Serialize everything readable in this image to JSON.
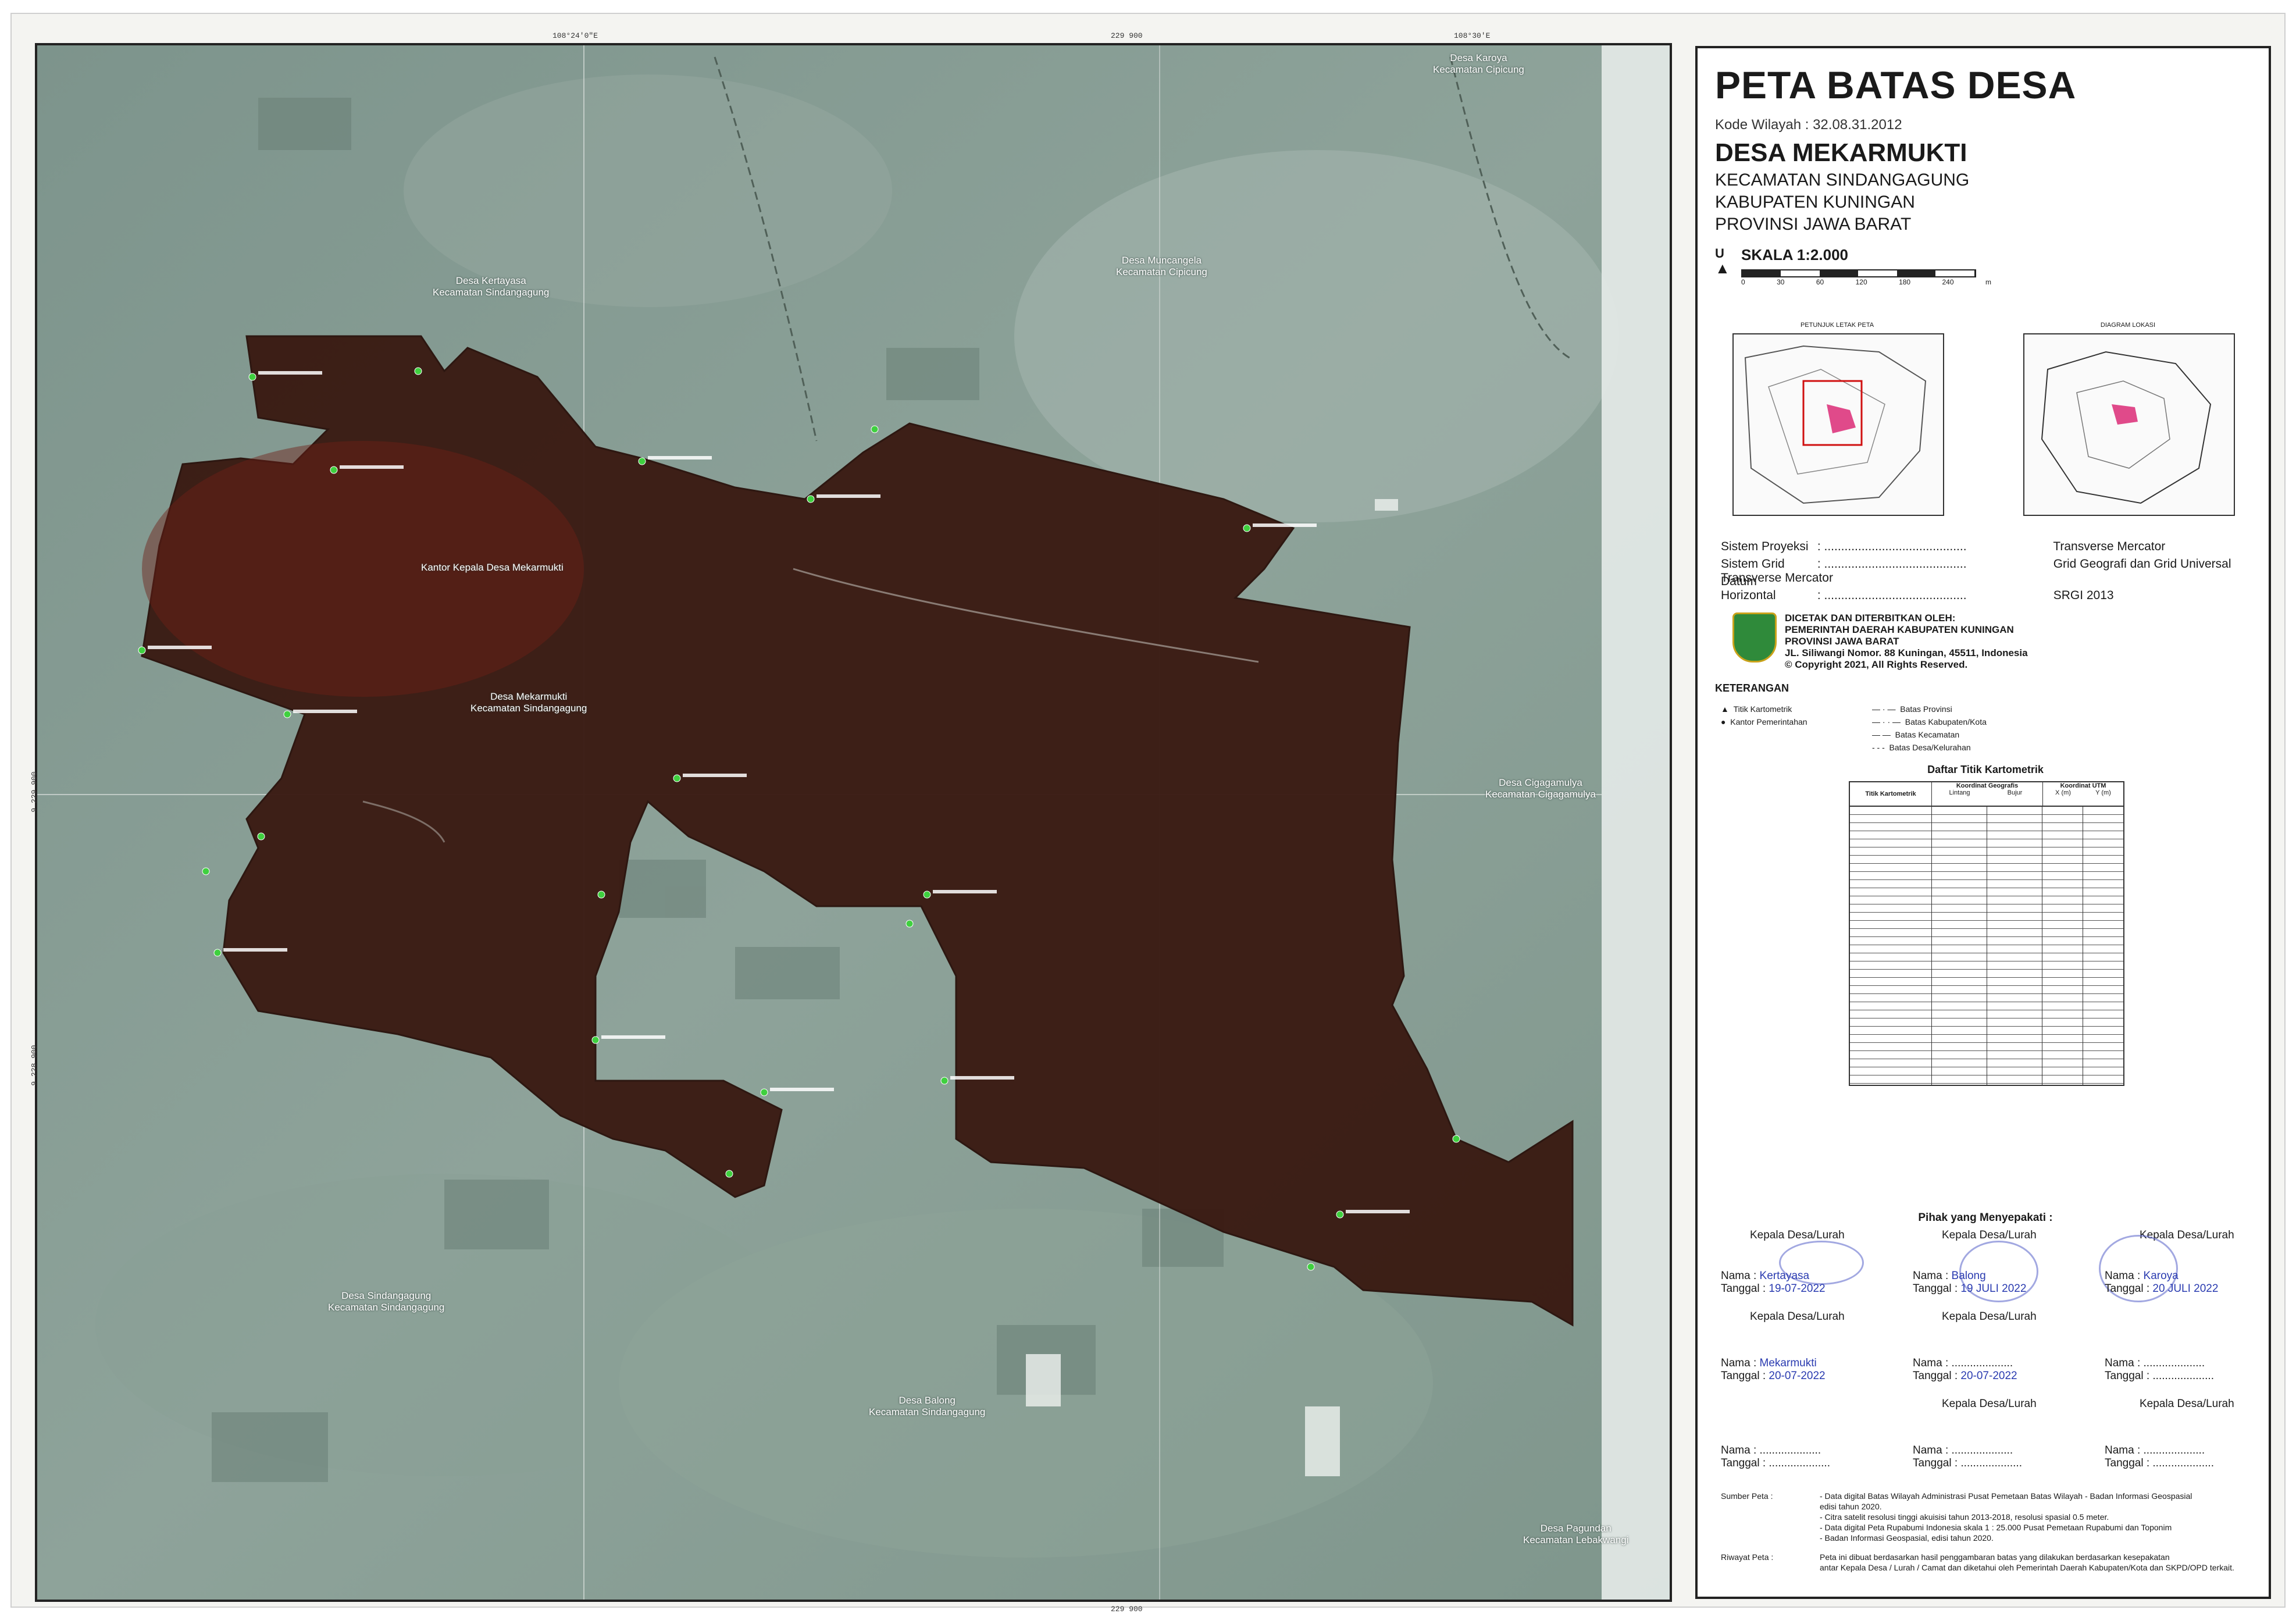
{
  "map": {
    "tick_top": [
      "108°24'0\"E",
      "229 900",
      "108°30'E"
    ],
    "tick_left": [
      "9 229 900",
      "9 228 900"
    ],
    "tick_bottom": [
      "229 900"
    ],
    "places": [
      {
        "name": "Desa Karoya",
        "sub": "Kecamatan Cipicung"
      },
      {
        "name": "Desa Kertayasa",
        "sub": "Kecamatan Sindangagung"
      },
      {
        "name": "Desa Muncangela",
        "sub": "Kecamatan Cipicung"
      },
      {
        "name": "Kantor Kepala Desa Mekarmukti",
        "sub": ""
      },
      {
        "name": "Desa Mekarmukti",
        "sub": "Kecamatan Sindangagung"
      },
      {
        "name": "Desa Cigagamulya",
        "sub": "Kecamatan Cigagamulya"
      },
      {
        "name": "Desa Sindangagung",
        "sub": "Kecamatan Sindangagung"
      },
      {
        "name": "Desa Balong",
        "sub": "Kecamatan Sindangagung"
      },
      {
        "name": "Desa Pagundan",
        "sub": "Kecamatan Lebakwangi"
      }
    ]
  },
  "panel": {
    "title": "PETA BATAS DESA",
    "kode": "Kode Wilayah : 32.08.31.2012",
    "desa": "DESA MEKARMUKTI",
    "kecamatan": "KECAMATAN SINDANGAGUNG",
    "kabupaten": "KABUPATEN KUNINGAN",
    "provinsi": "PROVINSI JAWA BARAT",
    "north": "U",
    "skala": "SKALA 1:2.000",
    "scale_ticks": [
      "0",
      "30",
      "60",
      "120",
      "180",
      "240"
    ],
    "scale_unit": "m",
    "inset1_title": "PETUNJUK LETAK PETA",
    "inset2_title": "DIAGRAM LOKASI",
    "info": [
      {
        "label": "Sistem Proyeksi",
        "value": "Transverse Mercator"
      },
      {
        "label": "Sistem Grid",
        "value": "Grid Geografi dan Grid Universal Transverse Mercator"
      },
      {
        "label": "Datum Horizontal",
        "value": "SRGI 2013"
      }
    ],
    "publisher": [
      "DICETAK DAN DITERBITKAN OLEH:",
      "PEMERINTAH DAERAH KABUPATEN KUNINGAN",
      "PROVINSI JAWA BARAT",
      "JL. Siliwangi Nomor. 88 Kuningan, 45511, Indonesia",
      "© Copyright 2021, All Rights Reserved."
    ],
    "keterangan_title": "KETERANGAN",
    "legend_left": [
      "Titik Kartometrik",
      "Kantor Pemerintahan"
    ],
    "legend_right": [
      "Batas Provinsi",
      "Batas Kabupaten/Kota",
      "Batas Kecamatan",
      "Batas Desa/Kelurahan"
    ],
    "table_title": "Daftar Titik Kartometrik",
    "table_headers": [
      "Titik Kartometrik",
      "Koordinat Geografis",
      "Koordinat UTM",
      "Lintang",
      "Bujur",
      "X (m)",
      "Y (m)"
    ],
    "pihak_title": "Pihak yang Menyepakati :",
    "sign_roles": [
      "Kepala Desa/Lurah",
      "Kepala Desa/Lurah",
      "Kepala Desa/Lurah",
      "Kepala Desa/Lurah",
      "Kepala Desa/Lurah",
      "",
      "",
      "Kepala Desa/Lurah",
      "Kepala Desa/Lurah"
    ],
    "sign_names": [
      "Kertayasa",
      "Balong",
      "Karoya",
      "Mekarmukti",
      "",
      "",
      "",
      "",
      ""
    ],
    "sign_dates": [
      "19-07-2022",
      "19 JULI 2022",
      "20 JULI 2022",
      "20-07-2022",
      "20-07-2022",
      "",
      "",
      "",
      ""
    ],
    "nama_label": "Nama",
    "tanggal_label": "Tanggal",
    "sumber_label": "Sumber Peta :",
    "sumber": [
      "- Data digital Batas Wilayah Administrasi Pusat Pemetaan Batas Wilayah - Badan Informasi Geospasial",
      "  edisi tahun 2020.",
      "- Citra satelit resolusi tinggi akuisisi tahun 2013-2018, resolusi spasial 0.5 meter.",
      "- Data digital Peta Rupabumi Indonesia skala 1 : 25.000 Pusat Pemetaan Rupabumi dan Toponim",
      "  - Badan Informasi Geospasial, edisi tahun 2020."
    ],
    "riwayat_label": "Riwayat Peta :",
    "riwayat": [
      "Peta ini dibuat berdasarkan hasil penggambaran batas yang dilakukan berdasarkan kesepakatan",
      "antar Kepala Desa / Lurah / Camat dan diketahui oleh Pemerintah Daerah Kabupaten/Kota dan SKPD/OPD terkait."
    ]
  }
}
